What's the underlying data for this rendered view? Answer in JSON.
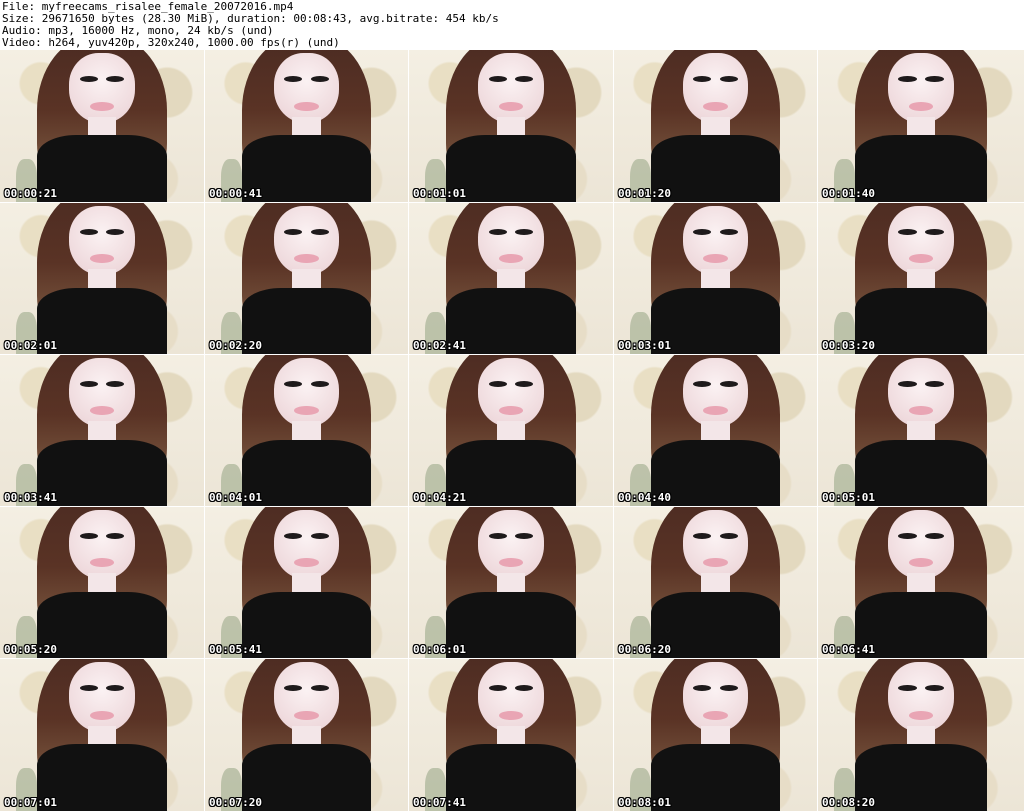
{
  "header": {
    "file": "File: myfreecams_risalee_female_20072016.mp4",
    "size": "Size: 29671650 bytes (28.30 MiB), duration: 00:08:43, avg.bitrate: 454 kb/s",
    "audio": "Audio: mp3, 16000 Hz, mono, 24 kb/s (und)",
    "video": "Video: h264, yuv420p, 320x240, 1000.00 fps(r) (und)"
  },
  "thumbnails": [
    {
      "timestamp": "00:00:21"
    },
    {
      "timestamp": "00:00:41"
    },
    {
      "timestamp": "00:01:01"
    },
    {
      "timestamp": "00:01:20"
    },
    {
      "timestamp": "00:01:40"
    },
    {
      "timestamp": "00:02:01"
    },
    {
      "timestamp": "00:02:20"
    },
    {
      "timestamp": "00:02:41"
    },
    {
      "timestamp": "00:03:01"
    },
    {
      "timestamp": "00:03:20"
    },
    {
      "timestamp": "00:03:41"
    },
    {
      "timestamp": "00:04:01"
    },
    {
      "timestamp": "00:04:21"
    },
    {
      "timestamp": "00:04:40"
    },
    {
      "timestamp": "00:05:01"
    },
    {
      "timestamp": "00:05:20"
    },
    {
      "timestamp": "00:05:41"
    },
    {
      "timestamp": "00:06:01"
    },
    {
      "timestamp": "00:06:20"
    },
    {
      "timestamp": "00:06:41"
    },
    {
      "timestamp": "00:07:01"
    },
    {
      "timestamp": "00:07:20"
    },
    {
      "timestamp": "00:07:41"
    },
    {
      "timestamp": "00:08:01"
    },
    {
      "timestamp": "00:08:20"
    }
  ]
}
